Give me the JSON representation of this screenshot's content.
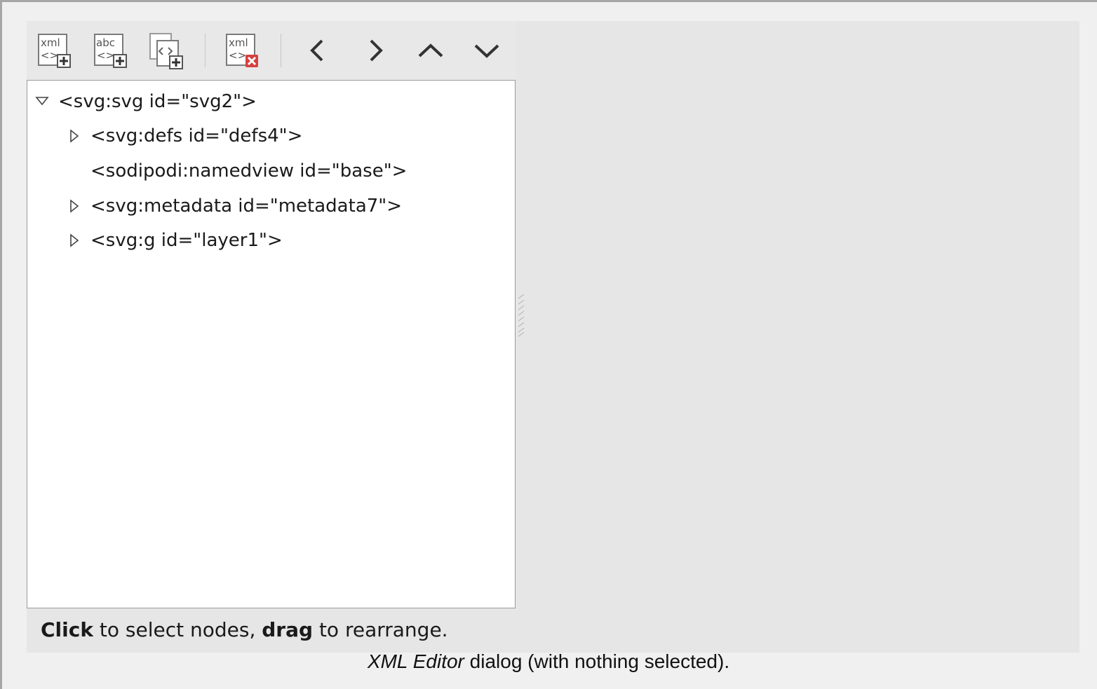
{
  "toolbar": {
    "buttons": [
      {
        "name": "new-element-node",
        "icon": "xml-add-icon",
        "glyph_top": "xml",
        "glyph_bottom": "<>"
      },
      {
        "name": "new-text-node",
        "icon": "abc-add-icon",
        "glyph_top": "abc",
        "glyph_bottom": "<>"
      },
      {
        "name": "duplicate-node",
        "icon": "duplicate-node-icon"
      },
      {
        "name": "delete-node",
        "icon": "xml-delete-icon",
        "glyph_top": "xml",
        "glyph_bottom": "<>"
      },
      {
        "name": "unindent-node",
        "icon": "chevron-left-icon"
      },
      {
        "name": "indent-node",
        "icon": "chevron-right-icon"
      },
      {
        "name": "raise-node",
        "icon": "chevron-up-icon"
      },
      {
        "name": "lower-node",
        "icon": "chevron-down-icon"
      }
    ]
  },
  "tree": {
    "nodes": [
      {
        "label": "<svg:svg id=\"svg2\">",
        "expander": "expanded"
      },
      {
        "label": "<svg:defs id=\"defs4\">",
        "expander": "collapsed"
      },
      {
        "label": "<sodipodi:namedview id=\"base\">",
        "expander": "none"
      },
      {
        "label": "<svg:metadata id=\"metadata7\">",
        "expander": "collapsed"
      },
      {
        "label": "<svg:g id=\"layer1\">",
        "expander": "collapsed"
      }
    ]
  },
  "status": {
    "click": "Click",
    "text1": " to select nodes, ",
    "drag": "drag",
    "text2": " to rearrange."
  },
  "caption": {
    "title": "XML Editor",
    "rest": " dialog (with nothing selected)."
  },
  "colors": {
    "page_bg": "#f0f0f0",
    "dialog_bg": "#e6e6e6",
    "tree_bg": "#ffffff",
    "delete_badge": "#d64040"
  }
}
